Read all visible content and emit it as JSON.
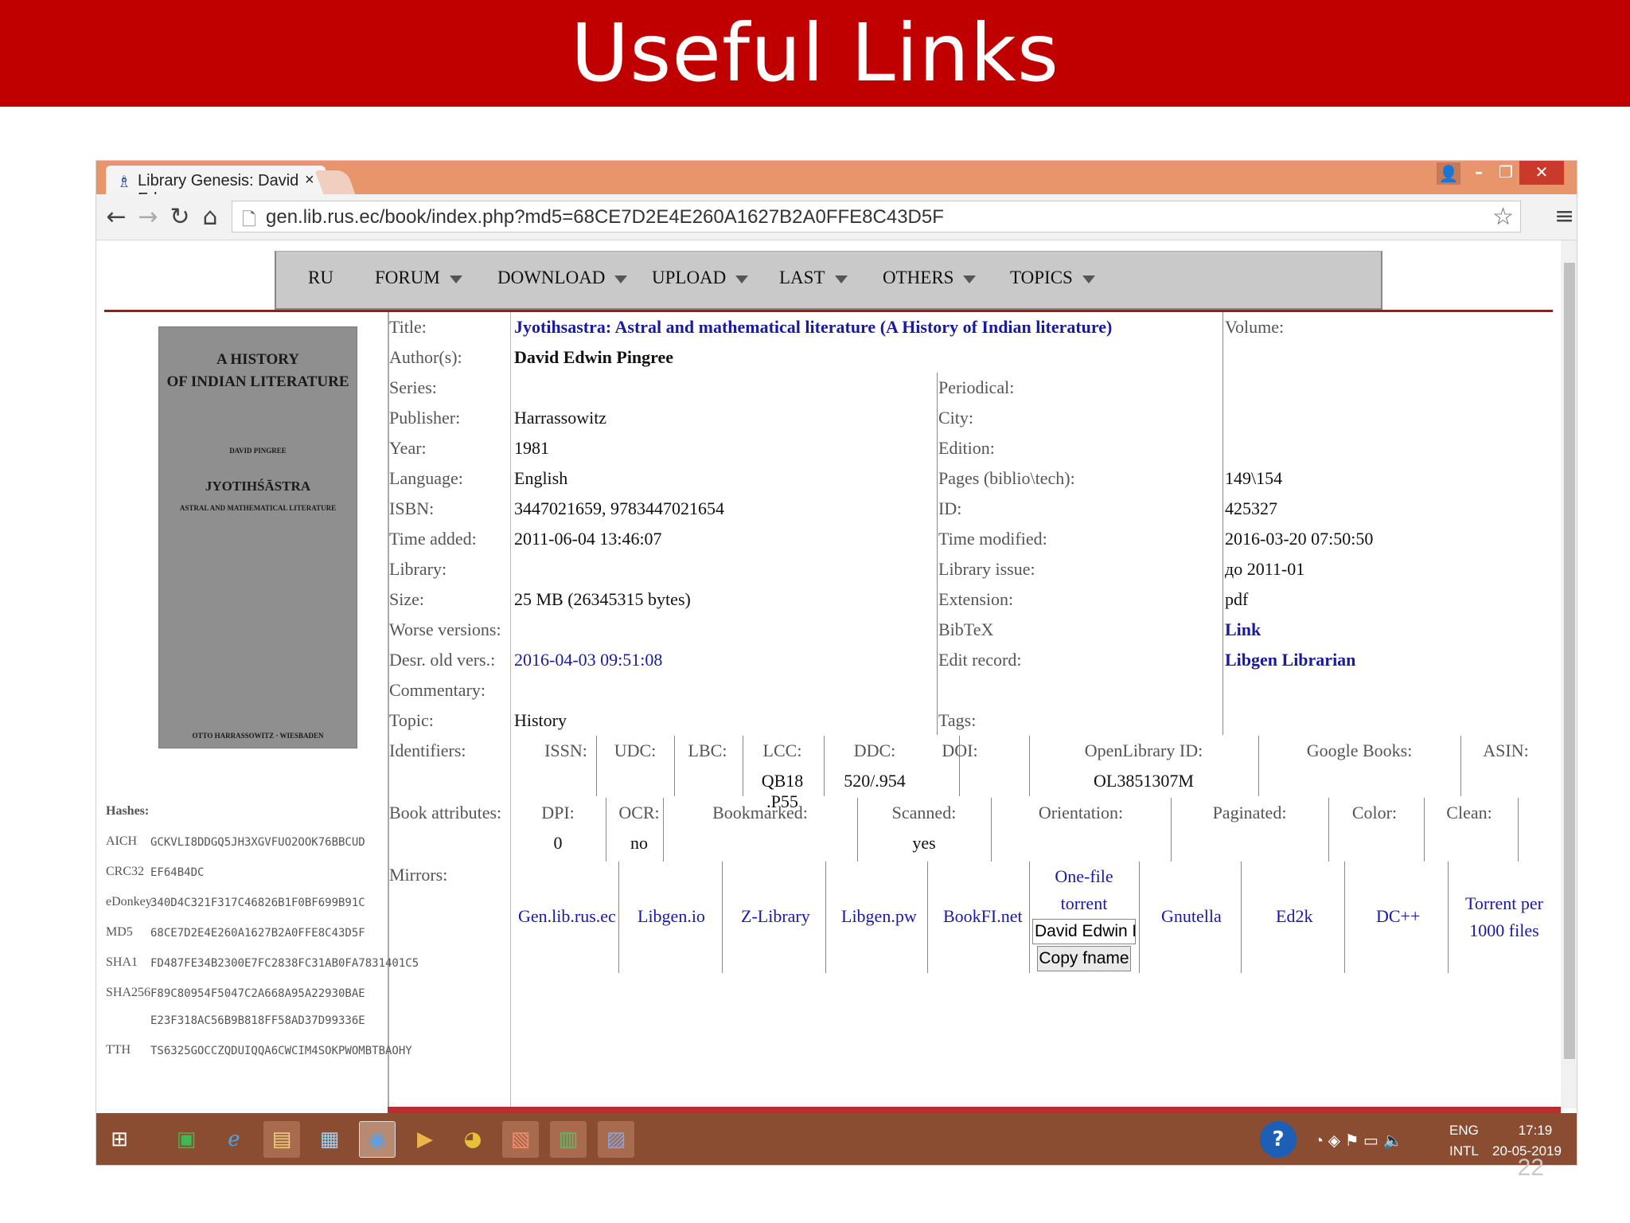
{
  "slide": {
    "title": "Useful Links",
    "number": "22"
  },
  "browser": {
    "tab_title": "Library Genesis: David Edv",
    "url": "gen.lib.rus.ec/book/index.php?md5=68CE7D2E4E260A1627B2A0FFE8C43D5F",
    "colors": {
      "titlebar": "#e8956b",
      "close": "#c93a2a"
    }
  },
  "nav": [
    "RU",
    "FORUM",
    "DOWNLOAD",
    "UPLOAD",
    "LAST",
    "OTHERS",
    "TOPICS"
  ],
  "cover": {
    "line1": "A HISTORY",
    "line2": "OF INDIAN LITERATURE",
    "author": "DAVID PINGREE",
    "title": "JYOTIHŚĀSTRA",
    "subtitle": "ASTRAL AND MATHEMATICAL LITERATURE",
    "publisher": "OTTO HARRASSOWITZ · WIESBADEN"
  },
  "book": {
    "title_label": "Title:",
    "title": "Jyotihsastra: Astral and mathematical literature (A History of Indian literature)",
    "volume_label": "Volume:",
    "author_label": "Author(s):",
    "author": "David Edwin Pingree",
    "series_label": "Series:",
    "periodical_label": "Periodical:",
    "publisher_label": "Publisher:",
    "publisher": "Harrassowitz",
    "city_label": "City:",
    "year_label": "Year:",
    "year": "1981",
    "edition_label": "Edition:",
    "language_label": "Language:",
    "language": "English",
    "pages_label": "Pages (biblio\\tech):",
    "pages": "149\\154",
    "isbn_label": "ISBN:",
    "isbn": "3447021659, 9783447021654",
    "id_label": "ID:",
    "id": "425327",
    "added_label": "Time added:",
    "added": "2011-06-04 13:46:07",
    "modified_label": "Time modified:",
    "modified": "2016-03-20 07:50:50",
    "library_label": "Library:",
    "issue_label": "Library issue:",
    "issue": "до 2011-01",
    "size_label": "Size:",
    "size": "25 MB (26345315 bytes)",
    "ext_label": "Extension:",
    "ext": "pdf",
    "worse_label": "Worse versions:",
    "bibtex_label": "BibTeX",
    "bibtex": "Link",
    "desr_label": "Desr. old vers.:",
    "desr": "2016-04-03 09:51:08",
    "edit_label": "Edit record:",
    "edit": "Libgen Librarian",
    "comment_label": "Commentary:",
    "topic_label": "Topic:",
    "topic": "History",
    "tags_label": "Tags:",
    "identifiers_label": "Identifiers:",
    "attributes_label": "Book attributes:",
    "mirrors_label": "Mirrors:"
  },
  "identifiers": {
    "issn": "ISSN:",
    "udc": "UDC:",
    "lbc": "LBC:",
    "lcc": "LCC:",
    "lcc_v": "QB18 .P55",
    "ddc": "DDC:",
    "ddc_v": "520/.954",
    "doi": "DOI:",
    "ol": "OpenLibrary ID:",
    "ol_v": "OL3851307M",
    "gb": "Google Books:",
    "asin": "ASIN:"
  },
  "attributes": {
    "dpi": "DPI:",
    "dpi_v": "0",
    "ocr": "OCR:",
    "ocr_v": "no",
    "bookmarked": "Bookmarked:",
    "scanned": "Scanned:",
    "scanned_v": "yes",
    "orientation": "Orientation:",
    "paginated": "Paginated:",
    "color": "Color:",
    "clean": "Clean:"
  },
  "mirrors": {
    "m1": "Gen.lib.rus.ec",
    "m2": "Libgen.io",
    "m3": "Z-Library",
    "m4": "Libgen.pw",
    "m5": "BookFI.net",
    "torrent1": "One-file",
    "torrent2": "torrent",
    "fname": "David Edwin Pingree",
    "copy": "Copy fname",
    "m7": "Gnutella",
    "m8": "Ed2k",
    "m9": "DC++",
    "m10a": "Torrent per",
    "m10b": "1000 files"
  },
  "hashes": {
    "label": "Hashes:",
    "aich_l": "AICH",
    "aich": "GCKVLI8DDGQ5JH3XGVFUO2OOK76BBCUD",
    "crc_l": "CRC32",
    "crc": "EF64B4DC",
    "ed_l": "eDonkey",
    "ed": "340D4C321F317C46826B1F0BF699B91C",
    "md5_l": "MD5",
    "md5": "68CE7D2E4E260A1627B2A0FFE8C43D5F",
    "sha1_l": "SHA1",
    "sha1": "FD487FE34B2300E7FC2838FC31AB0FA7831401C5",
    "sha256_l": "SHA256",
    "sha256a": "F89C80954F5047C2A668A95A22930BAE",
    "sha256b": "E23F318AC56B9B818FF58AD37D99336E",
    "tth_l": "TTH",
    "tth": "TS6325GOCCZQDUIQQA6CWCIM4SOKPWOMBTBAOHY"
  },
  "tray": {
    "lang1": "ENG",
    "lang2": "INTL",
    "time": "17:19",
    "date": "20-05-2019"
  }
}
